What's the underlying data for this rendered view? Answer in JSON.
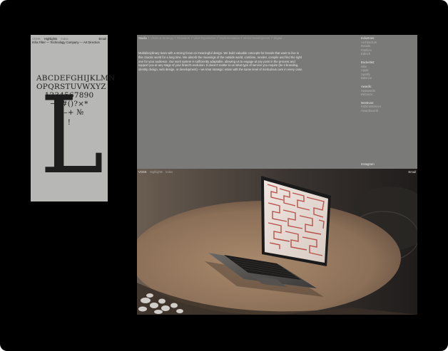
{
  "left_card": {
    "nav": {
      "brand": "VOSK",
      "highlights": "Highlights",
      "index": "Index",
      "email": "Email"
    },
    "subtitle": "Infra Filter — Technology Company — Art Direction",
    "specimen": {
      "row1": "ABCDEFGHIJKLMN",
      "row2": "OPQRSTUVWXYZ",
      "row3": "1234567890",
      "row4": "→•#()?×*",
      "row5": "÷:–+ №",
      "row6": "!",
      "big_letter": "L"
    }
  },
  "panel": {
    "crumbs": [
      {
        "label": "Studio",
        "active": true
      },
      {
        "label": "Vision & Strategy",
        "active": false
      },
      {
        "label": "Research",
        "active": false
      },
      {
        "label": "User Experience",
        "active": false
      },
      {
        "label": "Implementation",
        "active": false
      },
      {
        "label": "Brand Development",
        "active": false
      },
      {
        "label": "Digital",
        "active": false
      }
    ],
    "body": "Multidisciplinary team with a strong focus on meaningful design. We build valuable concepts for brands that want to live in this chaotic world for a long time. We absorb the meanings of the outside world, combine, reorder, compile and find the right one for your audience. Our work system is sufficiently adaptable, allowing us to engage at any point in the process and support you at any stage of your brand's evolution. It doesn't matter to us what type of service you require (be it branding, identity design, web design, or development) – we treat strategic vision with the same level of meticulous care in every case.",
    "meta": {
      "industries": {
        "head": "Industries:",
        "items": [
          "Architecture",
          "Retails",
          "Fashion",
          "Edtech"
        ]
      },
      "bucketlist": {
        "head": "Bucketlist:",
        "items": [
          "Nike",
          "Apple",
          "Spotify",
          "Balance"
        ]
      },
      "awards": {
        "head": "Awards:",
        "items": [
          "Awwwards",
          "Behance"
        ]
      },
      "mentions": {
        "head": "Mentions:",
        "items": [
          "#3DCssWinner",
          "Awardsworld"
        ]
      }
    },
    "instagram": "Instagram"
  },
  "photo": {
    "nav": {
      "brand": "VOSK",
      "highlights": "Highlights",
      "index": "Index",
      "email": "Email"
    }
  },
  "colors": {
    "background": "#000000",
    "card": "#b7b7b5",
    "panel": "#7a7a78",
    "screen_accent": "#b5433d"
  }
}
